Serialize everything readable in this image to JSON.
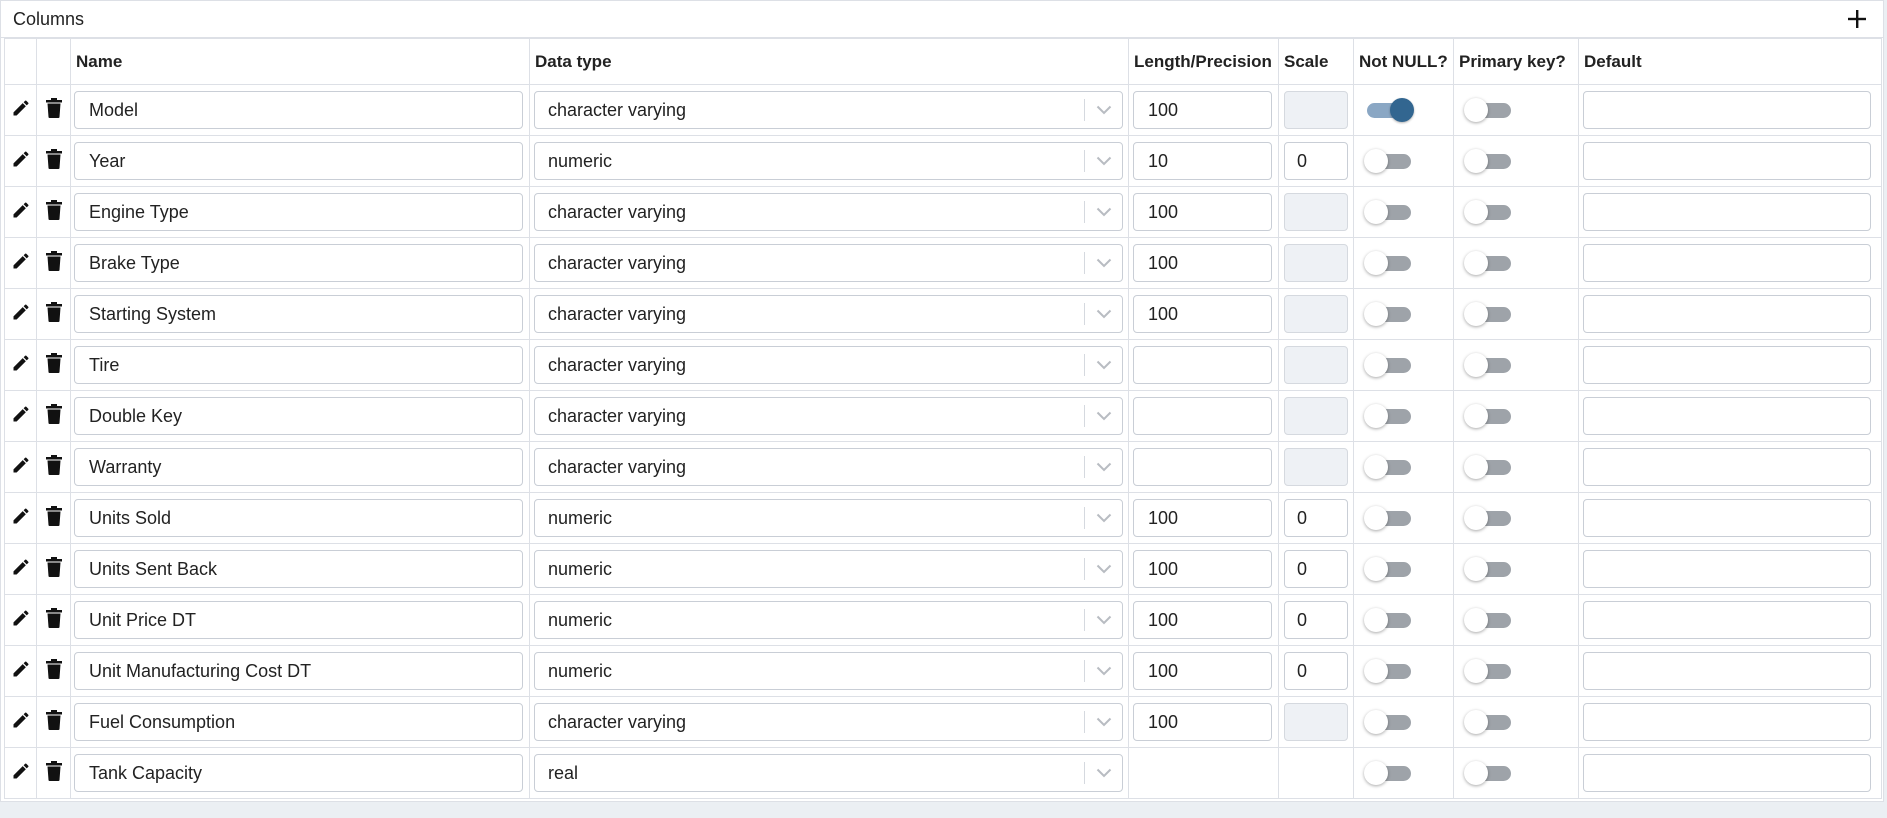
{
  "panel": {
    "title": "Columns",
    "add_icon": "plus-icon"
  },
  "table": {
    "headers": {
      "name": "Name",
      "data_type": "Data type",
      "length": "Length/Precision",
      "scale": "Scale",
      "not_null": "Not NULL?",
      "primary_key": "Primary key?",
      "default": "Default"
    },
    "row_icons": {
      "edit": "pencil-icon",
      "delete": "trash-icon",
      "dropdown": "chevron-down-icon"
    },
    "rows": [
      {
        "name": "Model",
        "data_type": "character varying",
        "length": "100",
        "scale": "",
        "scale_enabled": false,
        "length_shown": true,
        "not_null": true,
        "primary_key": false,
        "default": ""
      },
      {
        "name": "Year",
        "data_type": "numeric",
        "length": "10",
        "scale": "0",
        "scale_enabled": true,
        "length_shown": true,
        "not_null": false,
        "primary_key": false,
        "default": ""
      },
      {
        "name": "Engine Type",
        "data_type": "character varying",
        "length": "100",
        "scale": "",
        "scale_enabled": false,
        "length_shown": true,
        "not_null": false,
        "primary_key": false,
        "default": ""
      },
      {
        "name": "Brake Type",
        "data_type": "character varying",
        "length": "100",
        "scale": "",
        "scale_enabled": false,
        "length_shown": true,
        "not_null": false,
        "primary_key": false,
        "default": ""
      },
      {
        "name": "Starting System",
        "data_type": "character varying",
        "length": "100",
        "scale": "",
        "scale_enabled": false,
        "length_shown": true,
        "not_null": false,
        "primary_key": false,
        "default": ""
      },
      {
        "name": "Tire",
        "data_type": "character varying",
        "length": "",
        "scale": "",
        "scale_enabled": false,
        "length_shown": true,
        "not_null": false,
        "primary_key": false,
        "default": ""
      },
      {
        "name": "Double Key",
        "data_type": "character varying",
        "length": "",
        "scale": "",
        "scale_enabled": false,
        "length_shown": true,
        "not_null": false,
        "primary_key": false,
        "default": ""
      },
      {
        "name": "Warranty",
        "data_type": "character varying",
        "length": "",
        "scale": "",
        "scale_enabled": false,
        "length_shown": true,
        "not_null": false,
        "primary_key": false,
        "default": ""
      },
      {
        "name": "Units Sold",
        "data_type": "numeric",
        "length": "100",
        "scale": "0",
        "scale_enabled": true,
        "length_shown": true,
        "not_null": false,
        "primary_key": false,
        "default": ""
      },
      {
        "name": "Units Sent Back",
        "data_type": "numeric",
        "length": "100",
        "scale": "0",
        "scale_enabled": true,
        "length_shown": true,
        "not_null": false,
        "primary_key": false,
        "default": ""
      },
      {
        "name": "Unit Price DT",
        "data_type": "numeric",
        "length": "100",
        "scale": "0",
        "scale_enabled": true,
        "length_shown": true,
        "not_null": false,
        "primary_key": false,
        "default": ""
      },
      {
        "name": "Unit Manufacturing Cost DT",
        "data_type": "numeric",
        "length": "100",
        "scale": "0",
        "scale_enabled": true,
        "length_shown": true,
        "not_null": false,
        "primary_key": false,
        "default": ""
      },
      {
        "name": "Fuel Consumption",
        "data_type": "character varying",
        "length": "100",
        "scale": "",
        "scale_enabled": false,
        "length_shown": true,
        "not_null": false,
        "primary_key": false,
        "default": ""
      },
      {
        "name": "Tank Capacity",
        "data_type": "real",
        "length": "",
        "scale": "",
        "scale_enabled": null,
        "length_shown": false,
        "not_null": false,
        "primary_key": false,
        "default": ""
      }
    ]
  },
  "colors": {
    "toggle_on": "#326690",
    "toggle_on_track": "#8aa7c4",
    "toggle_off_track": "#9ea3a9",
    "border": "#dde0e6"
  }
}
